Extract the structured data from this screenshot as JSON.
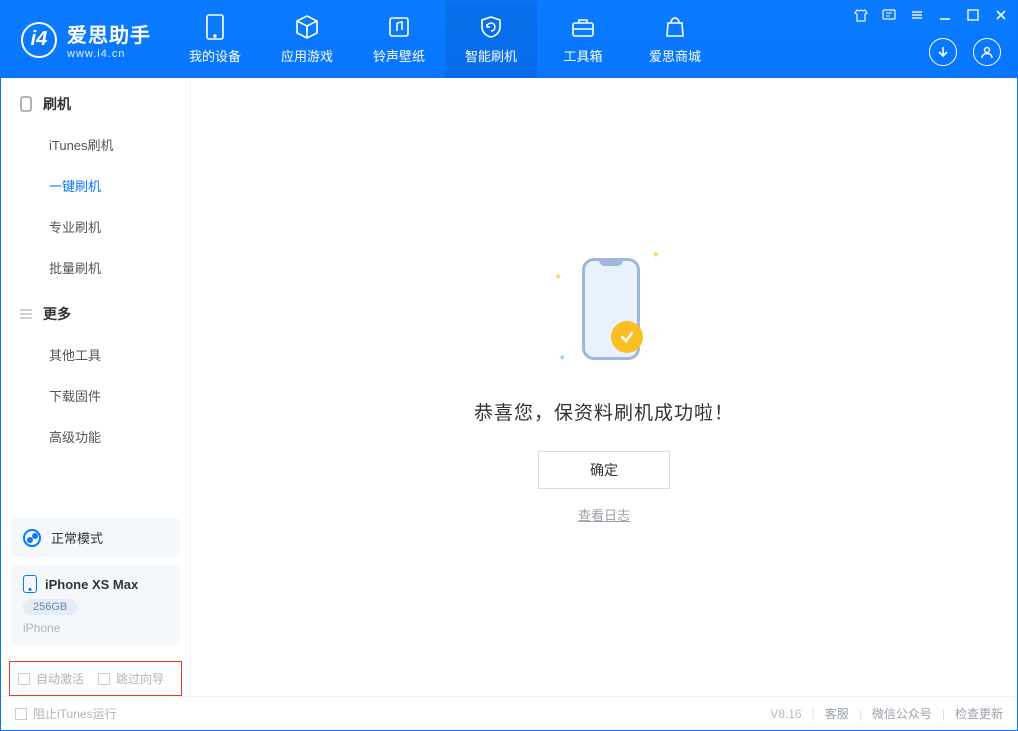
{
  "app": {
    "title": "爱思助手",
    "subtitle": "www.i4.cn"
  },
  "nav": {
    "items": [
      {
        "label": "我的设备"
      },
      {
        "label": "应用游戏"
      },
      {
        "label": "铃声壁纸"
      },
      {
        "label": "智能刷机"
      },
      {
        "label": "工具箱"
      },
      {
        "label": "爱思商城"
      }
    ],
    "active_index": 3
  },
  "sidebar": {
    "group1_title": "刷机",
    "group1": [
      {
        "label": "iTunes刷机"
      },
      {
        "label": "一键刷机"
      },
      {
        "label": "专业刷机"
      },
      {
        "label": "批量刷机"
      }
    ],
    "group1_active_index": 1,
    "group2_title": "更多",
    "group2": [
      {
        "label": "其他工具"
      },
      {
        "label": "下载固件"
      },
      {
        "label": "高级功能"
      }
    ],
    "mode_label": "正常模式",
    "device": {
      "name": "iPhone XS Max",
      "storage": "256GB",
      "type": "iPhone"
    },
    "options": {
      "auto_activate": "自动激活",
      "skip_guide": "跳过向导"
    }
  },
  "main": {
    "success_text": "恭喜您，保资料刷机成功啦！",
    "ok_button": "确定",
    "view_log": "查看日志"
  },
  "footer": {
    "block_itunes": "阻止iTunes运行",
    "version": "V8.16",
    "links": {
      "support": "客服",
      "wechat": "微信公众号",
      "update": "检查更新"
    }
  }
}
